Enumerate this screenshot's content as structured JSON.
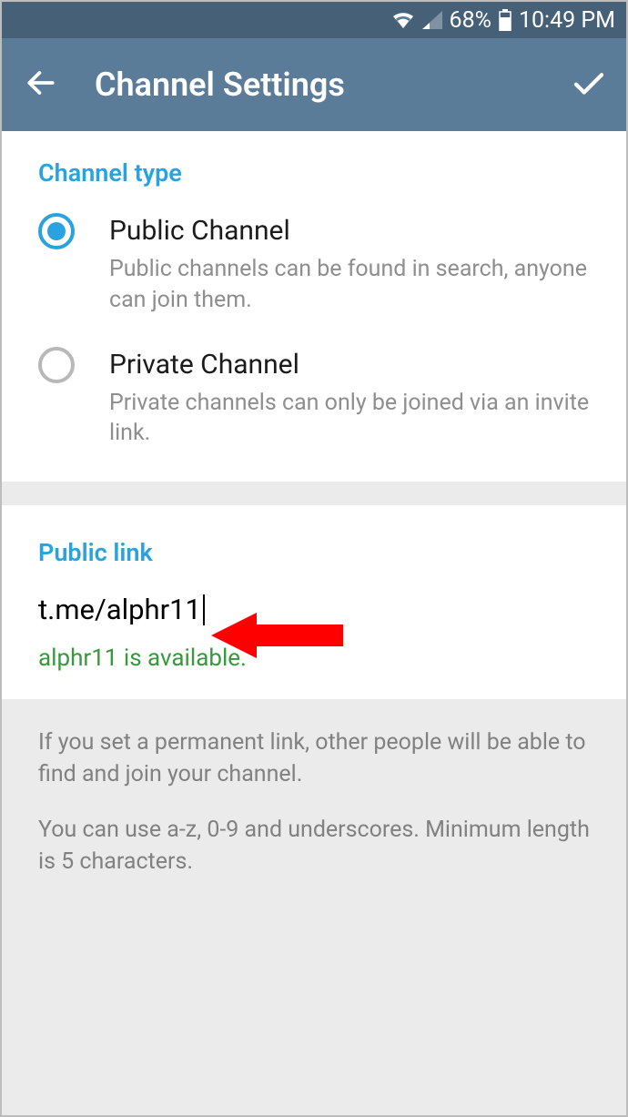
{
  "status": {
    "battery_pct": "68%",
    "time": "10:49 PM"
  },
  "appbar": {
    "title": "Channel Settings"
  },
  "channel_type": {
    "header": "Channel type",
    "options": [
      {
        "title": "Public Channel",
        "desc": "Public channels can be found in search, anyone can join them.",
        "selected": true
      },
      {
        "title": "Private Channel",
        "desc": "Private channels can only be joined via an invite link.",
        "selected": false
      }
    ]
  },
  "public_link": {
    "header": "Public link",
    "prefix": "t.me/",
    "value": "alphr11",
    "availability": "alphr11 is available."
  },
  "info": {
    "p1": "If you set a permanent link, other people will be able to find and join your channel.",
    "p2": "You can use a-z, 0-9 and underscores. Minimum length is 5 characters."
  }
}
